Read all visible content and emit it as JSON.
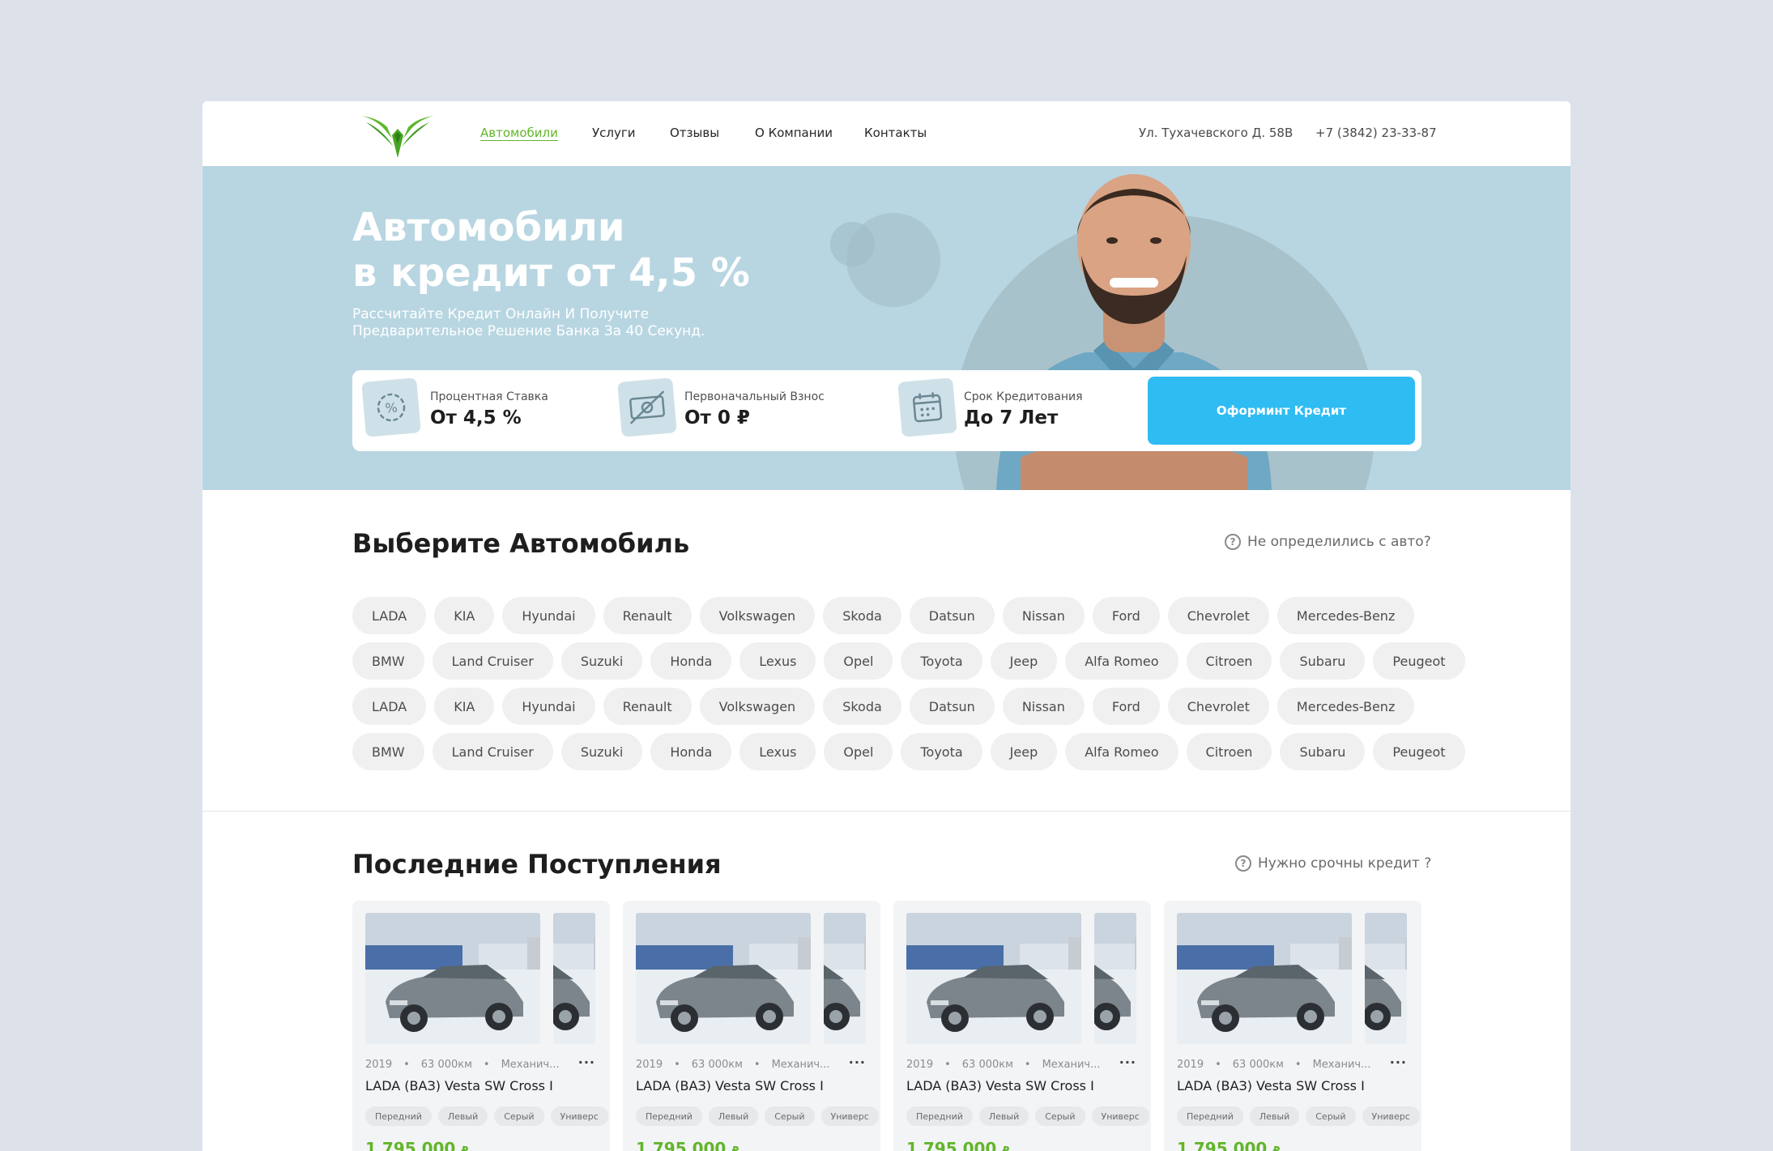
{
  "nav": {
    "items": [
      {
        "label": "Автомобили",
        "active": true
      },
      {
        "label": "Услуги",
        "active": false
      },
      {
        "label": "Отзывы",
        "active": false
      },
      {
        "label": "О Компании",
        "active": false
      },
      {
        "label": "Контакты",
        "active": false
      }
    ],
    "address": "Ул. Тухачевского Д. 58В",
    "phone": "+7 (3842) 23-33-87"
  },
  "hero": {
    "title_line1": "Автомобили",
    "title_line2": "в кредит от 4,5 %",
    "subtitle_line1": "Рассчитайте Кредит Онлайн И Получите",
    "subtitle_line2": "Предварительное Решение Банка За 40 Секунд.",
    "stats": [
      {
        "label": "Процентная Ставка",
        "value": "От 4,5 %",
        "icon": "percent-gear-icon"
      },
      {
        "label": "Первоначальный Взнос",
        "value": "От 0 ₽",
        "icon": "cash-icon"
      },
      {
        "label": "Срок Кредитования",
        "value": "До 7 Лет",
        "icon": "calendar-icon"
      }
    ],
    "cta_label": "Оформинт Кредит"
  },
  "brands_section": {
    "title": "Выберите Автомобиль",
    "help": "Не определились с авто?",
    "rows": [
      [
        "LADA",
        "KIA",
        "Hyundai",
        "Renault",
        "Volkswagen",
        "Skoda",
        "Datsun",
        "Nissan",
        "Ford",
        "Chevrolet",
        "Mercedes-Benz"
      ],
      [
        "BMW",
        "Land Cruiser",
        "Suzuki",
        "Honda",
        "Lexus",
        "Opel",
        "Toyota",
        "Jeep",
        "Alfa Romeo",
        "Citroen",
        "Subaru",
        "Peugeot"
      ],
      [
        "LADA",
        "KIA",
        "Hyundai",
        "Renault",
        "Volkswagen",
        "Skoda",
        "Datsun",
        "Nissan",
        "Ford",
        "Chevrolet",
        "Mercedes-Benz"
      ],
      [
        "BMW",
        "Land Cruiser",
        "Suzuki",
        "Honda",
        "Lexus",
        "Opel",
        "Toyota",
        "Jeep",
        "Alfa Romeo",
        "Citroen",
        "Subaru",
        "Peugeot"
      ]
    ]
  },
  "latest_section": {
    "title": "Последние Поступления",
    "help": "Нужно срочны кредит ?",
    "cards": [
      {
        "year": "2019",
        "mileage": "63 000км",
        "transmission": "Механич...",
        "more": "···",
        "title": "LADA (ВАЗ) Vesta SW Cross I",
        "tags": [
          "Передний",
          "Левый",
          "Серый",
          "Универс"
        ],
        "price": "1 795 000",
        "currency": "₽"
      },
      {
        "year": "2019",
        "mileage": "63 000км",
        "transmission": "Механич...",
        "more": "···",
        "title": "LADA (ВАЗ) Vesta SW Cross I",
        "tags": [
          "Передний",
          "Левый",
          "Серый",
          "Универс"
        ],
        "price": "1 795 000",
        "currency": "₽"
      },
      {
        "year": "2019",
        "mileage": "63 000км",
        "transmission": "Механич...",
        "more": "···",
        "title": "LADA (ВАЗ) Vesta SW Cross I",
        "tags": [
          "Передний",
          "Левый",
          "Серый",
          "Универс"
        ],
        "price": "1 795 000",
        "currency": "₽"
      },
      {
        "year": "2019",
        "mileage": "63 000км",
        "transmission": "Механич...",
        "more": "···",
        "title": "LADA (ВАЗ) Vesta SW Cross I",
        "tags": [
          "Передний",
          "Левый",
          "Серый",
          "Универс"
        ],
        "price": "1 795 000",
        "currency": "₽"
      }
    ]
  },
  "colors": {
    "accent_green": "#62b52a",
    "cta_blue": "#2fbcf2",
    "hero_bg": "#b8d6e1",
    "page_bg": "#dde2ea"
  }
}
